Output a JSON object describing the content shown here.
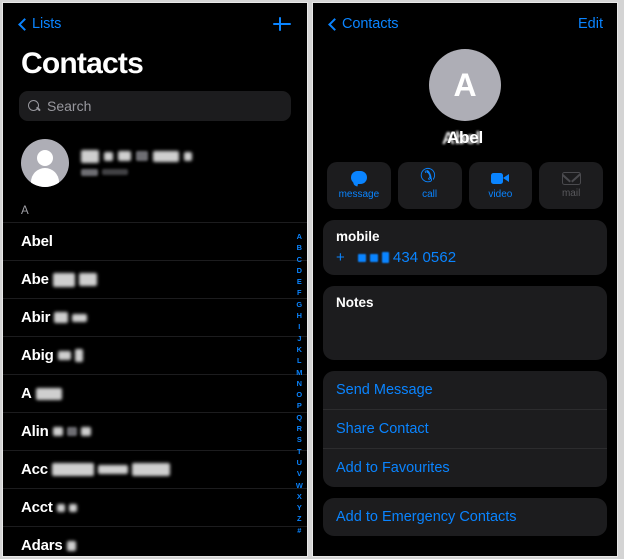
{
  "left_panel": {
    "nav": {
      "back_label": "Lists",
      "back_icon": "chevron-left-icon",
      "add_icon": "plus-icon"
    },
    "title": "Contacts",
    "search": {
      "icon": "search-icon",
      "placeholder": "Search",
      "value": ""
    },
    "my_card": {
      "avatar_icon": "person-placeholder-icon",
      "name": "[redacted]",
      "subtitle": "My Card"
    },
    "section_header": "A",
    "contacts": [
      {
        "name": "Abel",
        "redacted": false
      },
      {
        "name": "Abe",
        "redacted": true
      },
      {
        "name": "Abir",
        "redacted": true
      },
      {
        "name": "Abig",
        "redacted": true
      },
      {
        "name": "A",
        "redacted": true
      },
      {
        "name": "Alin",
        "redacted": true
      },
      {
        "name": "Acc",
        "redacted": true
      },
      {
        "name": "Acct",
        "redacted": true
      },
      {
        "name": "Adars",
        "redacted": true
      }
    ],
    "alphabet_index": [
      "A",
      "B",
      "C",
      "D",
      "E",
      "F",
      "G",
      "H",
      "I",
      "J",
      "K",
      "L",
      "M",
      "N",
      "O",
      "P",
      "Q",
      "R",
      "S",
      "T",
      "U",
      "V",
      "W",
      "X",
      "Y",
      "Z",
      "#"
    ]
  },
  "right_panel": {
    "nav": {
      "back_label": "Contacts",
      "back_icon": "chevron-left-icon",
      "edit_label": "Edit"
    },
    "contact": {
      "avatar_initial": "A",
      "name": "Abel"
    },
    "actions": [
      {
        "label": "message",
        "icon": "message-bubble-icon",
        "enabled": true
      },
      {
        "label": "call",
        "icon": "phone-handset-icon",
        "enabled": true
      },
      {
        "label": "video",
        "icon": "video-camera-icon",
        "enabled": true
      },
      {
        "label": "mail",
        "icon": "envelope-icon",
        "enabled": false
      }
    ],
    "phone": {
      "label": "mobile",
      "prefix": "+",
      "number_visible": "434 0562"
    },
    "notes": {
      "label": "Notes",
      "value": ""
    },
    "action_list": [
      "Send Message",
      "Share Contact",
      "Add to Favourites"
    ],
    "emergency_list": [
      "Add to Emergency Contacts"
    ]
  },
  "colors": {
    "accent_blue": "#0a84ff",
    "background": "#000000",
    "card": "#1c1c1e",
    "avatar_gray": "#aeaeb6",
    "disabled_gray": "#58585c",
    "secondary_text": "#98989e"
  }
}
